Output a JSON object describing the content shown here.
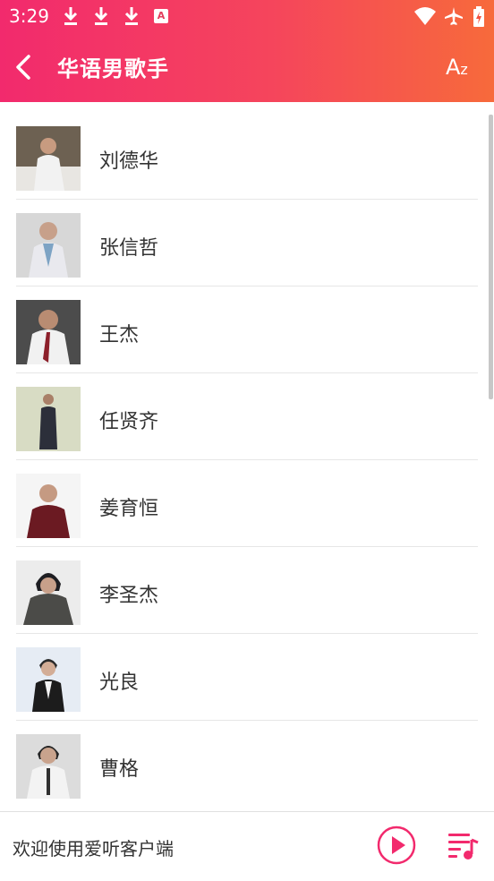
{
  "status_bar": {
    "time": "3:29",
    "notification_icons": [
      "download-icon",
      "download-icon",
      "download-icon",
      "a-icon"
    ],
    "system_icons": [
      "wifi-icon",
      "airplane-icon",
      "battery-charging-icon"
    ]
  },
  "app_bar": {
    "title": "华语男歌手",
    "sort_label_big": "A",
    "sort_label_small": "z"
  },
  "singers": [
    {
      "name": "刘德华"
    },
    {
      "name": "张信哲"
    },
    {
      "name": "王杰"
    },
    {
      "name": "任贤齐"
    },
    {
      "name": "姜育恒"
    },
    {
      "name": "李圣杰"
    },
    {
      "name": "光良"
    },
    {
      "name": "曹格"
    }
  ],
  "player": {
    "text": "欢迎使用爱听客户端"
  },
  "colors": {
    "accent": "#f22a6d",
    "gradient_end": "#f76a3b"
  }
}
